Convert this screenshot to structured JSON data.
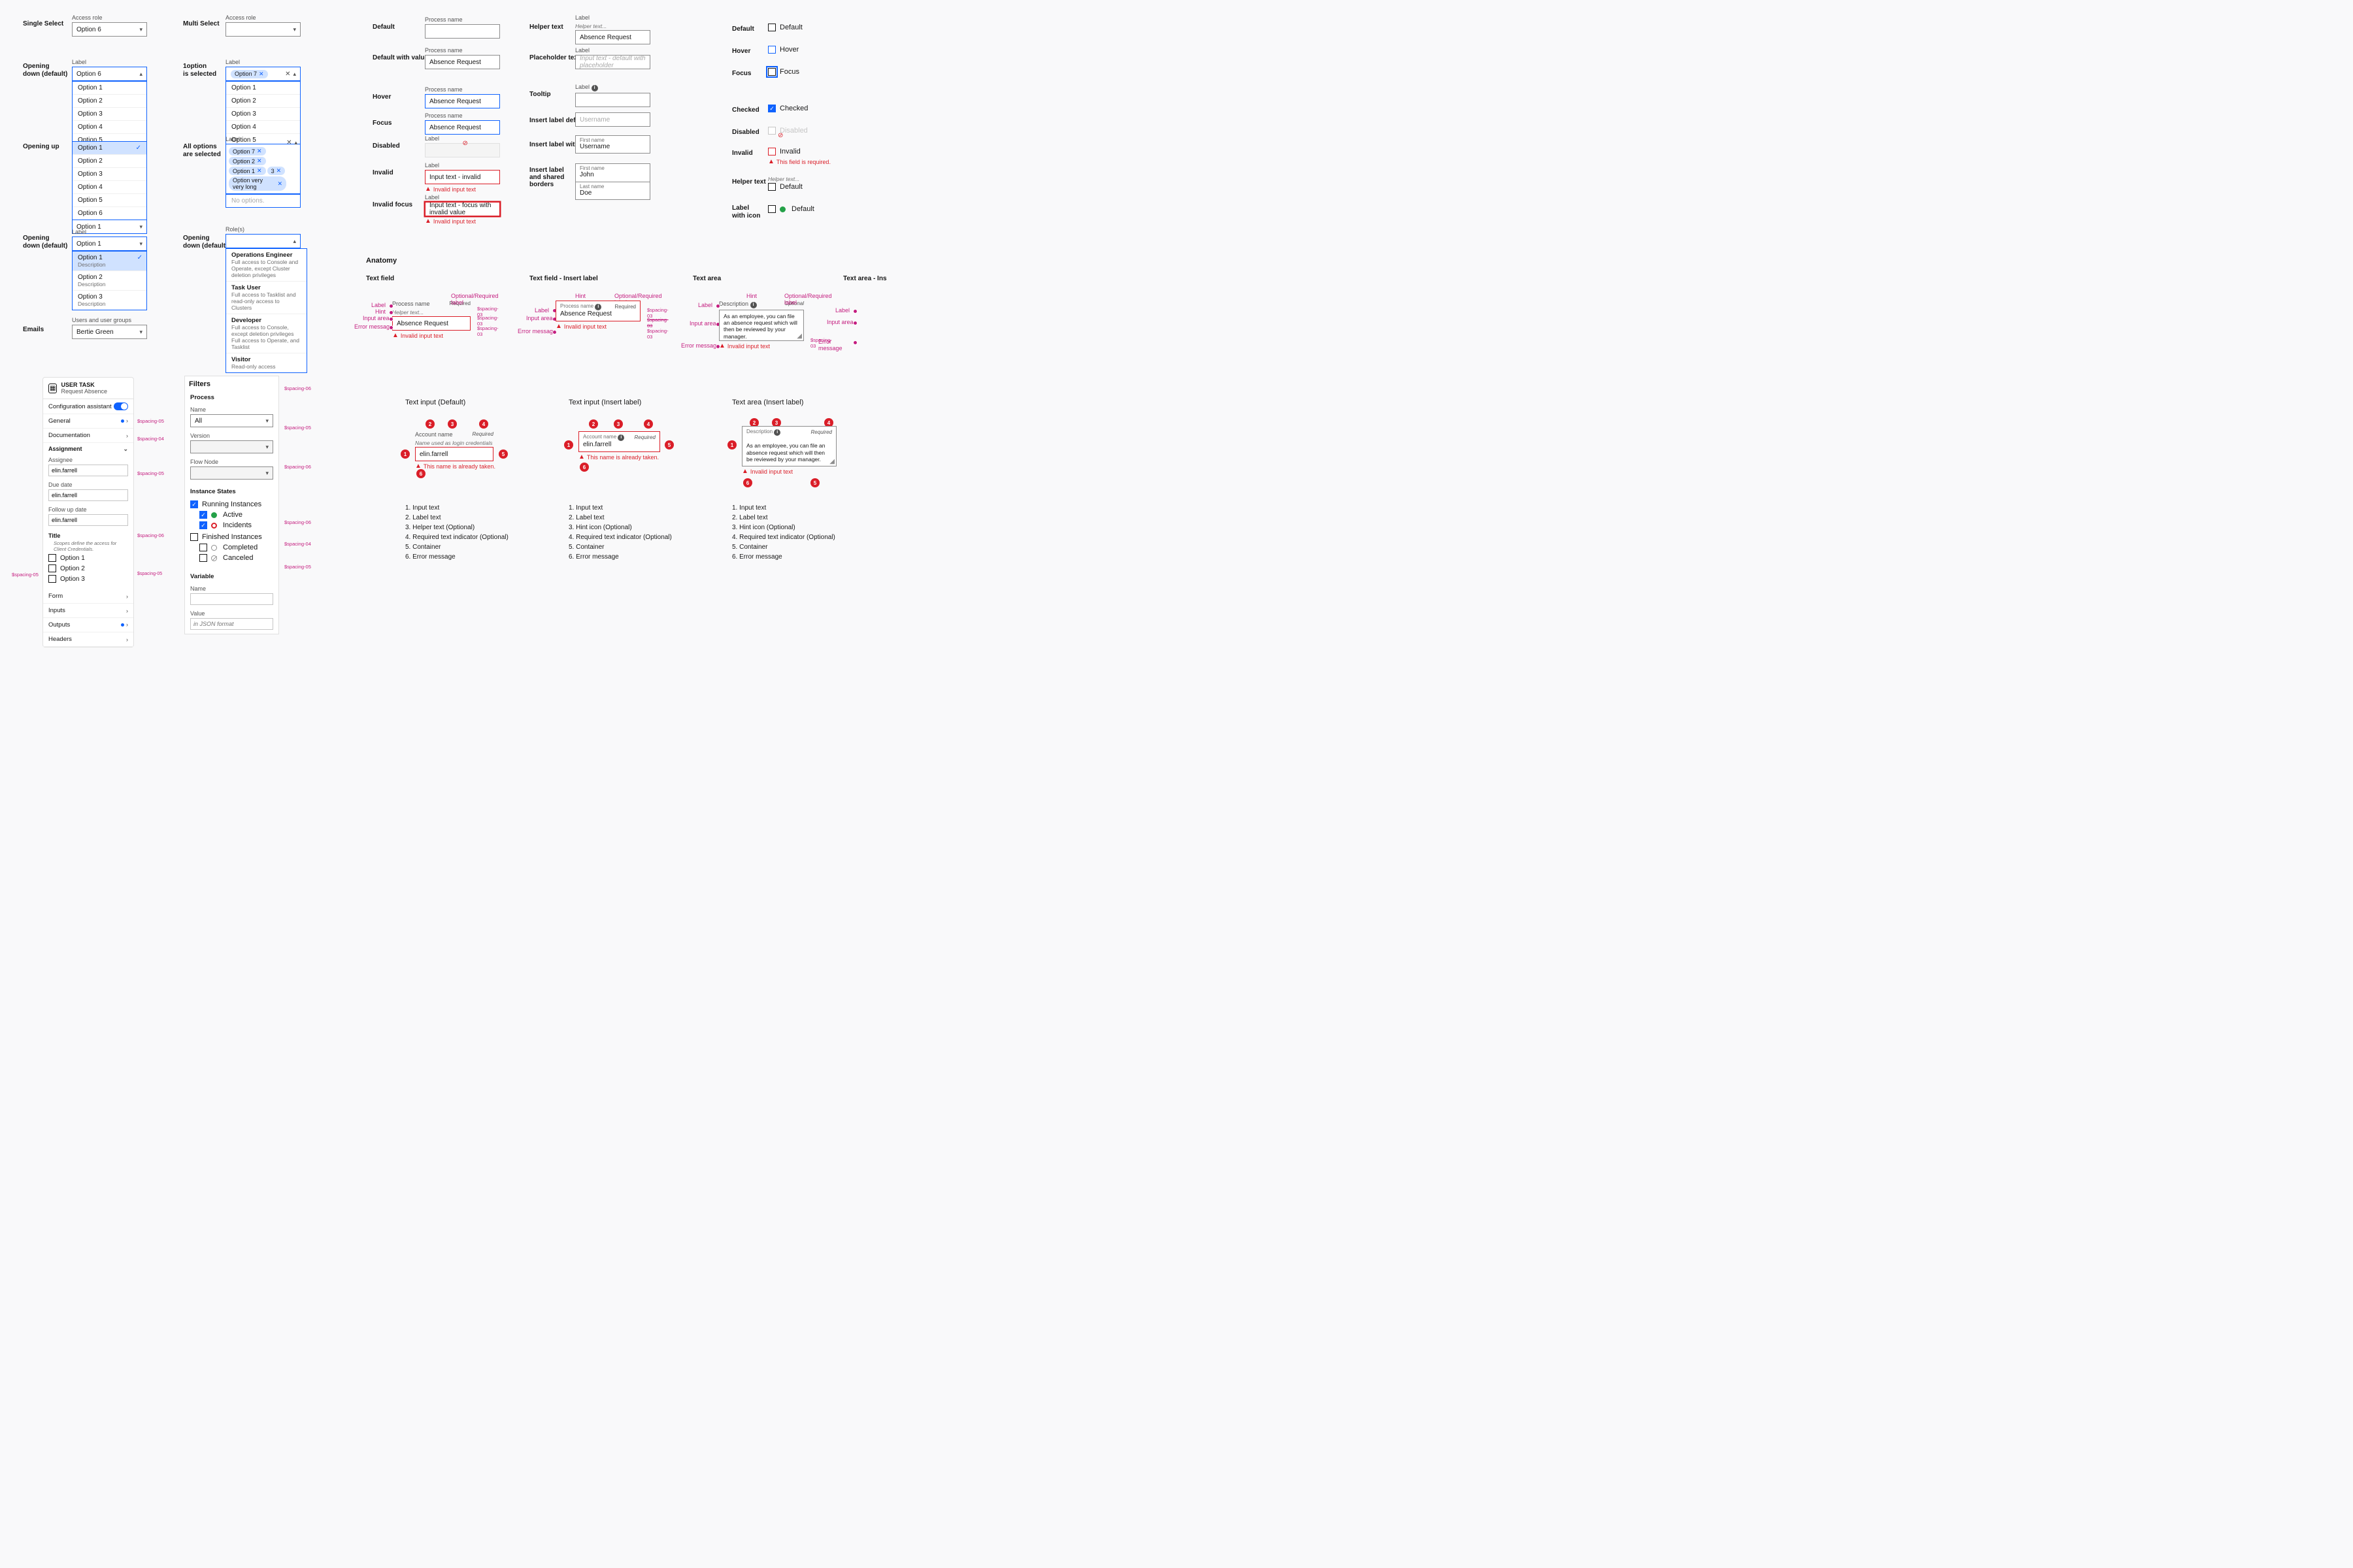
{
  "singleSelect": {
    "title": "Single Select",
    "label": "Access role",
    "value": "Option 6"
  },
  "multiSelect": {
    "title": "Multi Select",
    "label": "Access role"
  },
  "openingDown": {
    "title": "Opening\ndown (default)",
    "label": "Label",
    "value": "Option 6",
    "options": [
      "Option 1",
      "Option 2",
      "Option 3",
      "Option 4",
      "Option 5",
      "Option 6"
    ]
  },
  "oneOptionSelected": {
    "title": "1option\nis selected",
    "label": "Label",
    "chip": "Option 7",
    "options": [
      "Option 1",
      "Option 2",
      "Option 3",
      "Option 4",
      "Option 5",
      "Option 6"
    ]
  },
  "openingUp": {
    "title": "Opening up",
    "label": "Label",
    "value": "Option 1",
    "options": [
      "Option 1",
      "Option 2",
      "Option 3",
      "Option 4",
      "Option 5",
      "Option 6",
      "Option 1"
    ]
  },
  "allOptions": {
    "title": "All options\nare selected",
    "label": "Label",
    "chips": [
      "Option 7",
      "Option 2",
      "Option 1",
      "3",
      "Option very very long"
    ],
    "noopt": "No options."
  },
  "openingDown2": {
    "title": "Opening\ndown (default)",
    "label": "Label",
    "value": "Option 1",
    "options": [
      {
        "t": "Option 1",
        "d": "Description"
      },
      {
        "t": "Option 2",
        "d": "Description"
      },
      {
        "t": "Option 3",
        "d": "Description"
      }
    ]
  },
  "roles": {
    "title": "Opening\ndown (default)",
    "label": "Role(s)",
    "items": [
      {
        "t": "Operations Engineer",
        "d": "Full access to Console and Operate, except Cluster deletion privileges"
      },
      {
        "t": "Task User",
        "d": "Full access to Tasklist and read-only access to Clusters"
      },
      {
        "t": "Developer",
        "d": "Full access to Console, except deletion privileges\nFull access to Operate, and Tasklist"
      },
      {
        "t": "Visitor",
        "d": "Read-only access"
      }
    ]
  },
  "emails": {
    "title": "Emails",
    "label": "Users and user groups",
    "value": "Bertie Green"
  },
  "textField": {
    "default": {
      "row": "Default",
      "label": "Process name"
    },
    "defaultValue": {
      "row": "Default with value",
      "label": "Process name",
      "value": "Absence Request"
    },
    "hover": {
      "row": "Hover",
      "label": "Process name",
      "value": "Absence Request"
    },
    "focus": {
      "row": "Focus",
      "label": "Process name",
      "value": "Absence Request"
    },
    "disabled": {
      "row": "Disabled",
      "label": "Label"
    },
    "invalid": {
      "row": "Invalid",
      "label": "Label",
      "value": "Input text - invalid",
      "err": "Invalid input text"
    },
    "invalidFocus": {
      "row": "Invalid focus",
      "label": "Label",
      "value": "Input text - focus with invalid value",
      "err": "Invalid input text"
    }
  },
  "textField2": {
    "helperText": {
      "row": "Helper text",
      "label": "Label",
      "helper": "Helper text...",
      "value": "Absence Request"
    },
    "placeholder": {
      "row": "Placeholder text",
      "label": "Label",
      "value": "Input text - default with placeholder"
    },
    "tooltip": {
      "row": "Tooltip",
      "label": "Label"
    },
    "insertDefault": {
      "row": "Insert label default",
      "value": "Username"
    },
    "insertText": {
      "row": "Insert label with text",
      "inner": "First name",
      "value": "Username"
    },
    "insertShared": {
      "row": "Insert label and shared borders",
      "inner1": "First name",
      "value1": "John",
      "inner2": "Last name",
      "value2": "Doe"
    }
  },
  "checkboxes": {
    "default": {
      "row": "Default",
      "label": "Default"
    },
    "hover": {
      "row": "Hover",
      "label": "Hover"
    },
    "focus": {
      "row": "Focus",
      "label": "Focus"
    },
    "checked": {
      "row": "Checked",
      "label": "Checked"
    },
    "disabled": {
      "row": "Disabled",
      "label": "Disabled"
    },
    "invalid": {
      "row": "Invalid",
      "label": "Invalid",
      "err": "This field is required."
    },
    "helperText": {
      "row": "Helper text",
      "helper": "Helper text...",
      "label": "Default"
    },
    "withIcon": {
      "row": "Label\nwith icon",
      "label": "Default"
    }
  },
  "userTask": {
    "badge": "USER TASK",
    "title": "Request Absence",
    "configAssist": "Configuration assistant",
    "general": "General",
    "documentation": "Documentation",
    "assignment": "Assignment",
    "assignee": "Assignee",
    "assigneeVal": "elin.farrell",
    "dueDate": "Due date",
    "dueDateVal": "elin.farrell",
    "followUp": "Follow up date",
    "followUpVal": "elin.farrell",
    "titleField": "Title",
    "scopeNote": "Scopes define the access for Client Credentials.",
    "opts": [
      "Option 1",
      "Option 2",
      "Option 3"
    ],
    "form": "Form",
    "inputs": "Inputs",
    "outputs": "Outputs",
    "headers": "Headers"
  },
  "filters": {
    "title": "Filters",
    "process": "Process",
    "name": "Name",
    "all": "All",
    "version": "Version",
    "flowNode": "Flow Node",
    "instanceStates": "Instance States",
    "running": "Running Instances",
    "active": "Active",
    "incidents": "Incidents",
    "finished": "Finished Instances",
    "completed": "Completed",
    "canceled": "Canceled",
    "variable": "Variable",
    "valueLabel": "Value",
    "valuePlaceholder": "in JSON format"
  },
  "spacing": {
    "s03": "$spacing-03",
    "s04": "$spacing-04",
    "s05": "$spacing-05",
    "s06": "$spacing-06"
  },
  "anatomy": {
    "header": "Anatomy",
    "textField": "Text field",
    "textFieldInsert": "Text field - Insert label",
    "textArea": "Text area",
    "textAreaInsert": "Text area - Ins",
    "label": "Label",
    "hint": "Hint",
    "inputArea": "Input area",
    "errorMsg": "Error message",
    "optReq": "Optional/Required label",
    "required": "Required",
    "processName": "Process name",
    "helper": "Helper text...",
    "absence": "Absence Request",
    "invalid": "Invalid input text",
    "description": "Description",
    "optional": "Optional",
    "areaBody": "As an employee, you can file an absence request which will then be reviewed by your manager."
  },
  "examples": {
    "ti": "Text input (Default)",
    "tiInsert": "Text input (Insert label)",
    "taInsert": "Text area (Insert label)",
    "accountName": "Account name",
    "nameUsed": "Name used as login credentials",
    "required": "Required",
    "elin": "elin.farrell",
    "taken": "This name is already taken.",
    "desc": "Description",
    "areaBody": "As an employee, you can file an absence request which will then be reviewed by your manager.",
    "invalid": "Invalid input text",
    "list": [
      "Input text",
      "Label text",
      "Helper text (Optional)",
      "Required text indicator (Optional)",
      "Container",
      "Error message"
    ],
    "list2": [
      "Input text",
      "Label text",
      "Hint icon (Optional)",
      "Required text indicator (Optional)",
      "Container",
      "Error message"
    ]
  }
}
